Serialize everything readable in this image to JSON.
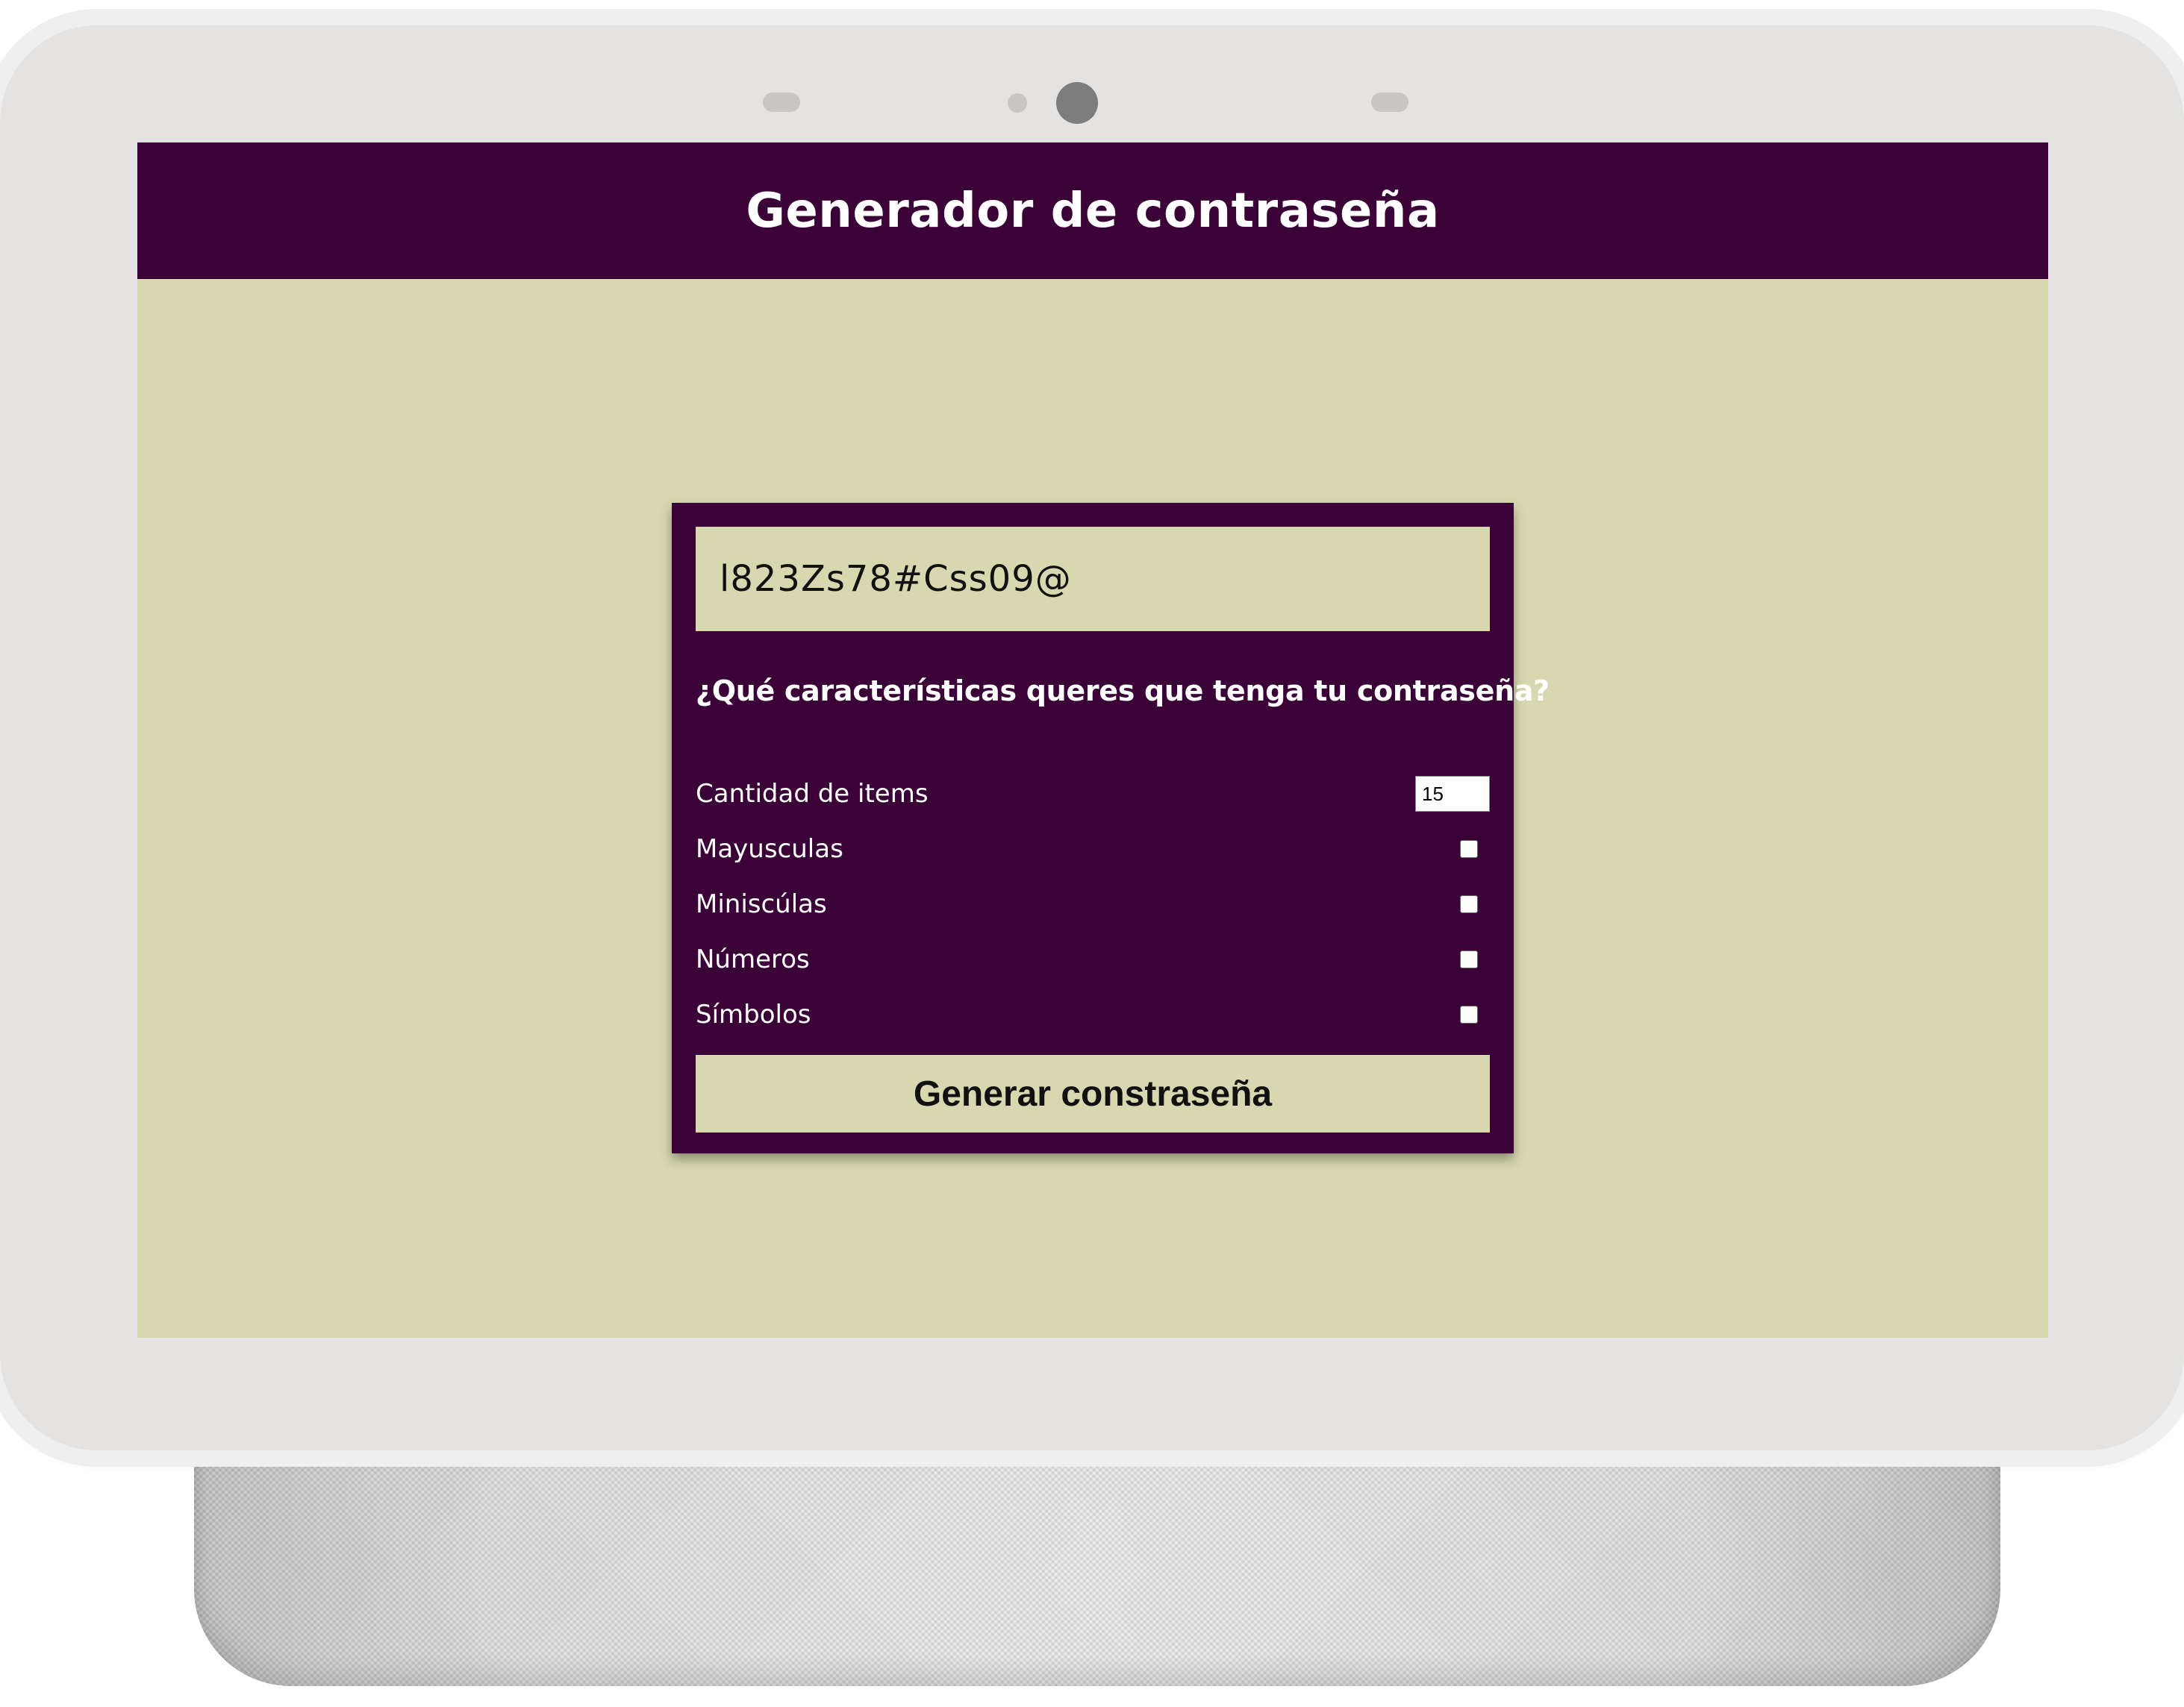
{
  "app": {
    "title": "Generador de contraseña"
  },
  "password": {
    "value": "l823Zs78#Css09@"
  },
  "options": {
    "question": "¿Qué características queres que tenga tu contraseña?",
    "quantity_label": "Cantidad de items",
    "quantity_value": "15",
    "uppercase_label": "Mayusculas",
    "lowercase_label": "Miniscúlas",
    "numbers_label": "Números",
    "symbols_label": "Símbolos"
  },
  "actions": {
    "generate_label": "Generar constraseña"
  },
  "colors": {
    "primary": "#3b0238",
    "background": "#d7d8b0",
    "text_light": "#ffffff"
  }
}
